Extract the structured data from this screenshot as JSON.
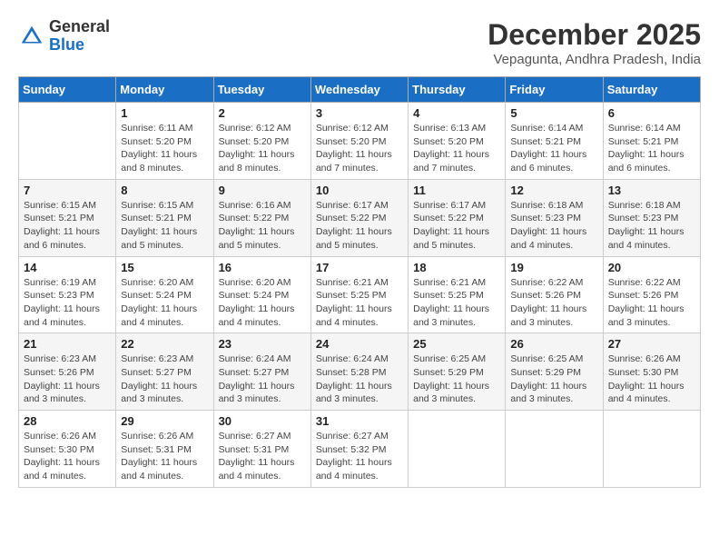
{
  "header": {
    "logo_general": "General",
    "logo_blue": "Blue",
    "month_title": "December 2025",
    "location": "Vepagunta, Andhra Pradesh, India"
  },
  "days_of_week": [
    "Sunday",
    "Monday",
    "Tuesday",
    "Wednesday",
    "Thursday",
    "Friday",
    "Saturday"
  ],
  "weeks": [
    [
      {
        "day": "",
        "info": ""
      },
      {
        "day": "1",
        "info": "Sunrise: 6:11 AM\nSunset: 5:20 PM\nDaylight: 11 hours\nand 8 minutes."
      },
      {
        "day": "2",
        "info": "Sunrise: 6:12 AM\nSunset: 5:20 PM\nDaylight: 11 hours\nand 8 minutes."
      },
      {
        "day": "3",
        "info": "Sunrise: 6:12 AM\nSunset: 5:20 PM\nDaylight: 11 hours\nand 7 minutes."
      },
      {
        "day": "4",
        "info": "Sunrise: 6:13 AM\nSunset: 5:20 PM\nDaylight: 11 hours\nand 7 minutes."
      },
      {
        "day": "5",
        "info": "Sunrise: 6:14 AM\nSunset: 5:21 PM\nDaylight: 11 hours\nand 6 minutes."
      },
      {
        "day": "6",
        "info": "Sunrise: 6:14 AM\nSunset: 5:21 PM\nDaylight: 11 hours\nand 6 minutes."
      }
    ],
    [
      {
        "day": "7",
        "info": "Sunrise: 6:15 AM\nSunset: 5:21 PM\nDaylight: 11 hours\nand 6 minutes."
      },
      {
        "day": "8",
        "info": "Sunrise: 6:15 AM\nSunset: 5:21 PM\nDaylight: 11 hours\nand 5 minutes."
      },
      {
        "day": "9",
        "info": "Sunrise: 6:16 AM\nSunset: 5:22 PM\nDaylight: 11 hours\nand 5 minutes."
      },
      {
        "day": "10",
        "info": "Sunrise: 6:17 AM\nSunset: 5:22 PM\nDaylight: 11 hours\nand 5 minutes."
      },
      {
        "day": "11",
        "info": "Sunrise: 6:17 AM\nSunset: 5:22 PM\nDaylight: 11 hours\nand 5 minutes."
      },
      {
        "day": "12",
        "info": "Sunrise: 6:18 AM\nSunset: 5:23 PM\nDaylight: 11 hours\nand 4 minutes."
      },
      {
        "day": "13",
        "info": "Sunrise: 6:18 AM\nSunset: 5:23 PM\nDaylight: 11 hours\nand 4 minutes."
      }
    ],
    [
      {
        "day": "14",
        "info": "Sunrise: 6:19 AM\nSunset: 5:23 PM\nDaylight: 11 hours\nand 4 minutes."
      },
      {
        "day": "15",
        "info": "Sunrise: 6:20 AM\nSunset: 5:24 PM\nDaylight: 11 hours\nand 4 minutes."
      },
      {
        "day": "16",
        "info": "Sunrise: 6:20 AM\nSunset: 5:24 PM\nDaylight: 11 hours\nand 4 minutes."
      },
      {
        "day": "17",
        "info": "Sunrise: 6:21 AM\nSunset: 5:25 PM\nDaylight: 11 hours\nand 4 minutes."
      },
      {
        "day": "18",
        "info": "Sunrise: 6:21 AM\nSunset: 5:25 PM\nDaylight: 11 hours\nand 3 minutes."
      },
      {
        "day": "19",
        "info": "Sunrise: 6:22 AM\nSunset: 5:26 PM\nDaylight: 11 hours\nand 3 minutes."
      },
      {
        "day": "20",
        "info": "Sunrise: 6:22 AM\nSunset: 5:26 PM\nDaylight: 11 hours\nand 3 minutes."
      }
    ],
    [
      {
        "day": "21",
        "info": "Sunrise: 6:23 AM\nSunset: 5:26 PM\nDaylight: 11 hours\nand 3 minutes."
      },
      {
        "day": "22",
        "info": "Sunrise: 6:23 AM\nSunset: 5:27 PM\nDaylight: 11 hours\nand 3 minutes."
      },
      {
        "day": "23",
        "info": "Sunrise: 6:24 AM\nSunset: 5:27 PM\nDaylight: 11 hours\nand 3 minutes."
      },
      {
        "day": "24",
        "info": "Sunrise: 6:24 AM\nSunset: 5:28 PM\nDaylight: 11 hours\nand 3 minutes."
      },
      {
        "day": "25",
        "info": "Sunrise: 6:25 AM\nSunset: 5:29 PM\nDaylight: 11 hours\nand 3 minutes."
      },
      {
        "day": "26",
        "info": "Sunrise: 6:25 AM\nSunset: 5:29 PM\nDaylight: 11 hours\nand 3 minutes."
      },
      {
        "day": "27",
        "info": "Sunrise: 6:26 AM\nSunset: 5:30 PM\nDaylight: 11 hours\nand 4 minutes."
      }
    ],
    [
      {
        "day": "28",
        "info": "Sunrise: 6:26 AM\nSunset: 5:30 PM\nDaylight: 11 hours\nand 4 minutes."
      },
      {
        "day": "29",
        "info": "Sunrise: 6:26 AM\nSunset: 5:31 PM\nDaylight: 11 hours\nand 4 minutes."
      },
      {
        "day": "30",
        "info": "Sunrise: 6:27 AM\nSunset: 5:31 PM\nDaylight: 11 hours\nand 4 minutes."
      },
      {
        "day": "31",
        "info": "Sunrise: 6:27 AM\nSunset: 5:32 PM\nDaylight: 11 hours\nand 4 minutes."
      },
      {
        "day": "",
        "info": ""
      },
      {
        "day": "",
        "info": ""
      },
      {
        "day": "",
        "info": ""
      }
    ]
  ]
}
